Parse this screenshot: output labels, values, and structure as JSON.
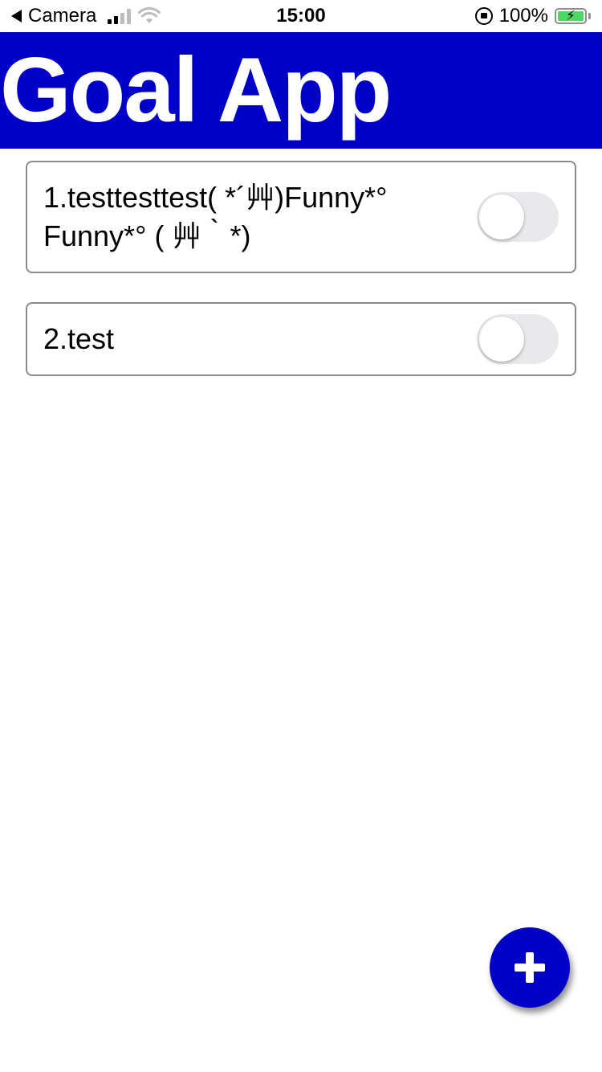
{
  "status_bar": {
    "back_app": "Camera",
    "time": "15:00",
    "battery": "100%"
  },
  "header": {
    "title": "Goal App",
    "background": "#0000c6"
  },
  "goals": [
    {
      "text": "1.testtesttest( *´艸)Funny*° Funny*° ( 艸｀*)",
      "completed": false
    },
    {
      "text": "2.test",
      "completed": false
    }
  ],
  "fab": {
    "icon": "plus-icon",
    "color": "#0000c6"
  }
}
